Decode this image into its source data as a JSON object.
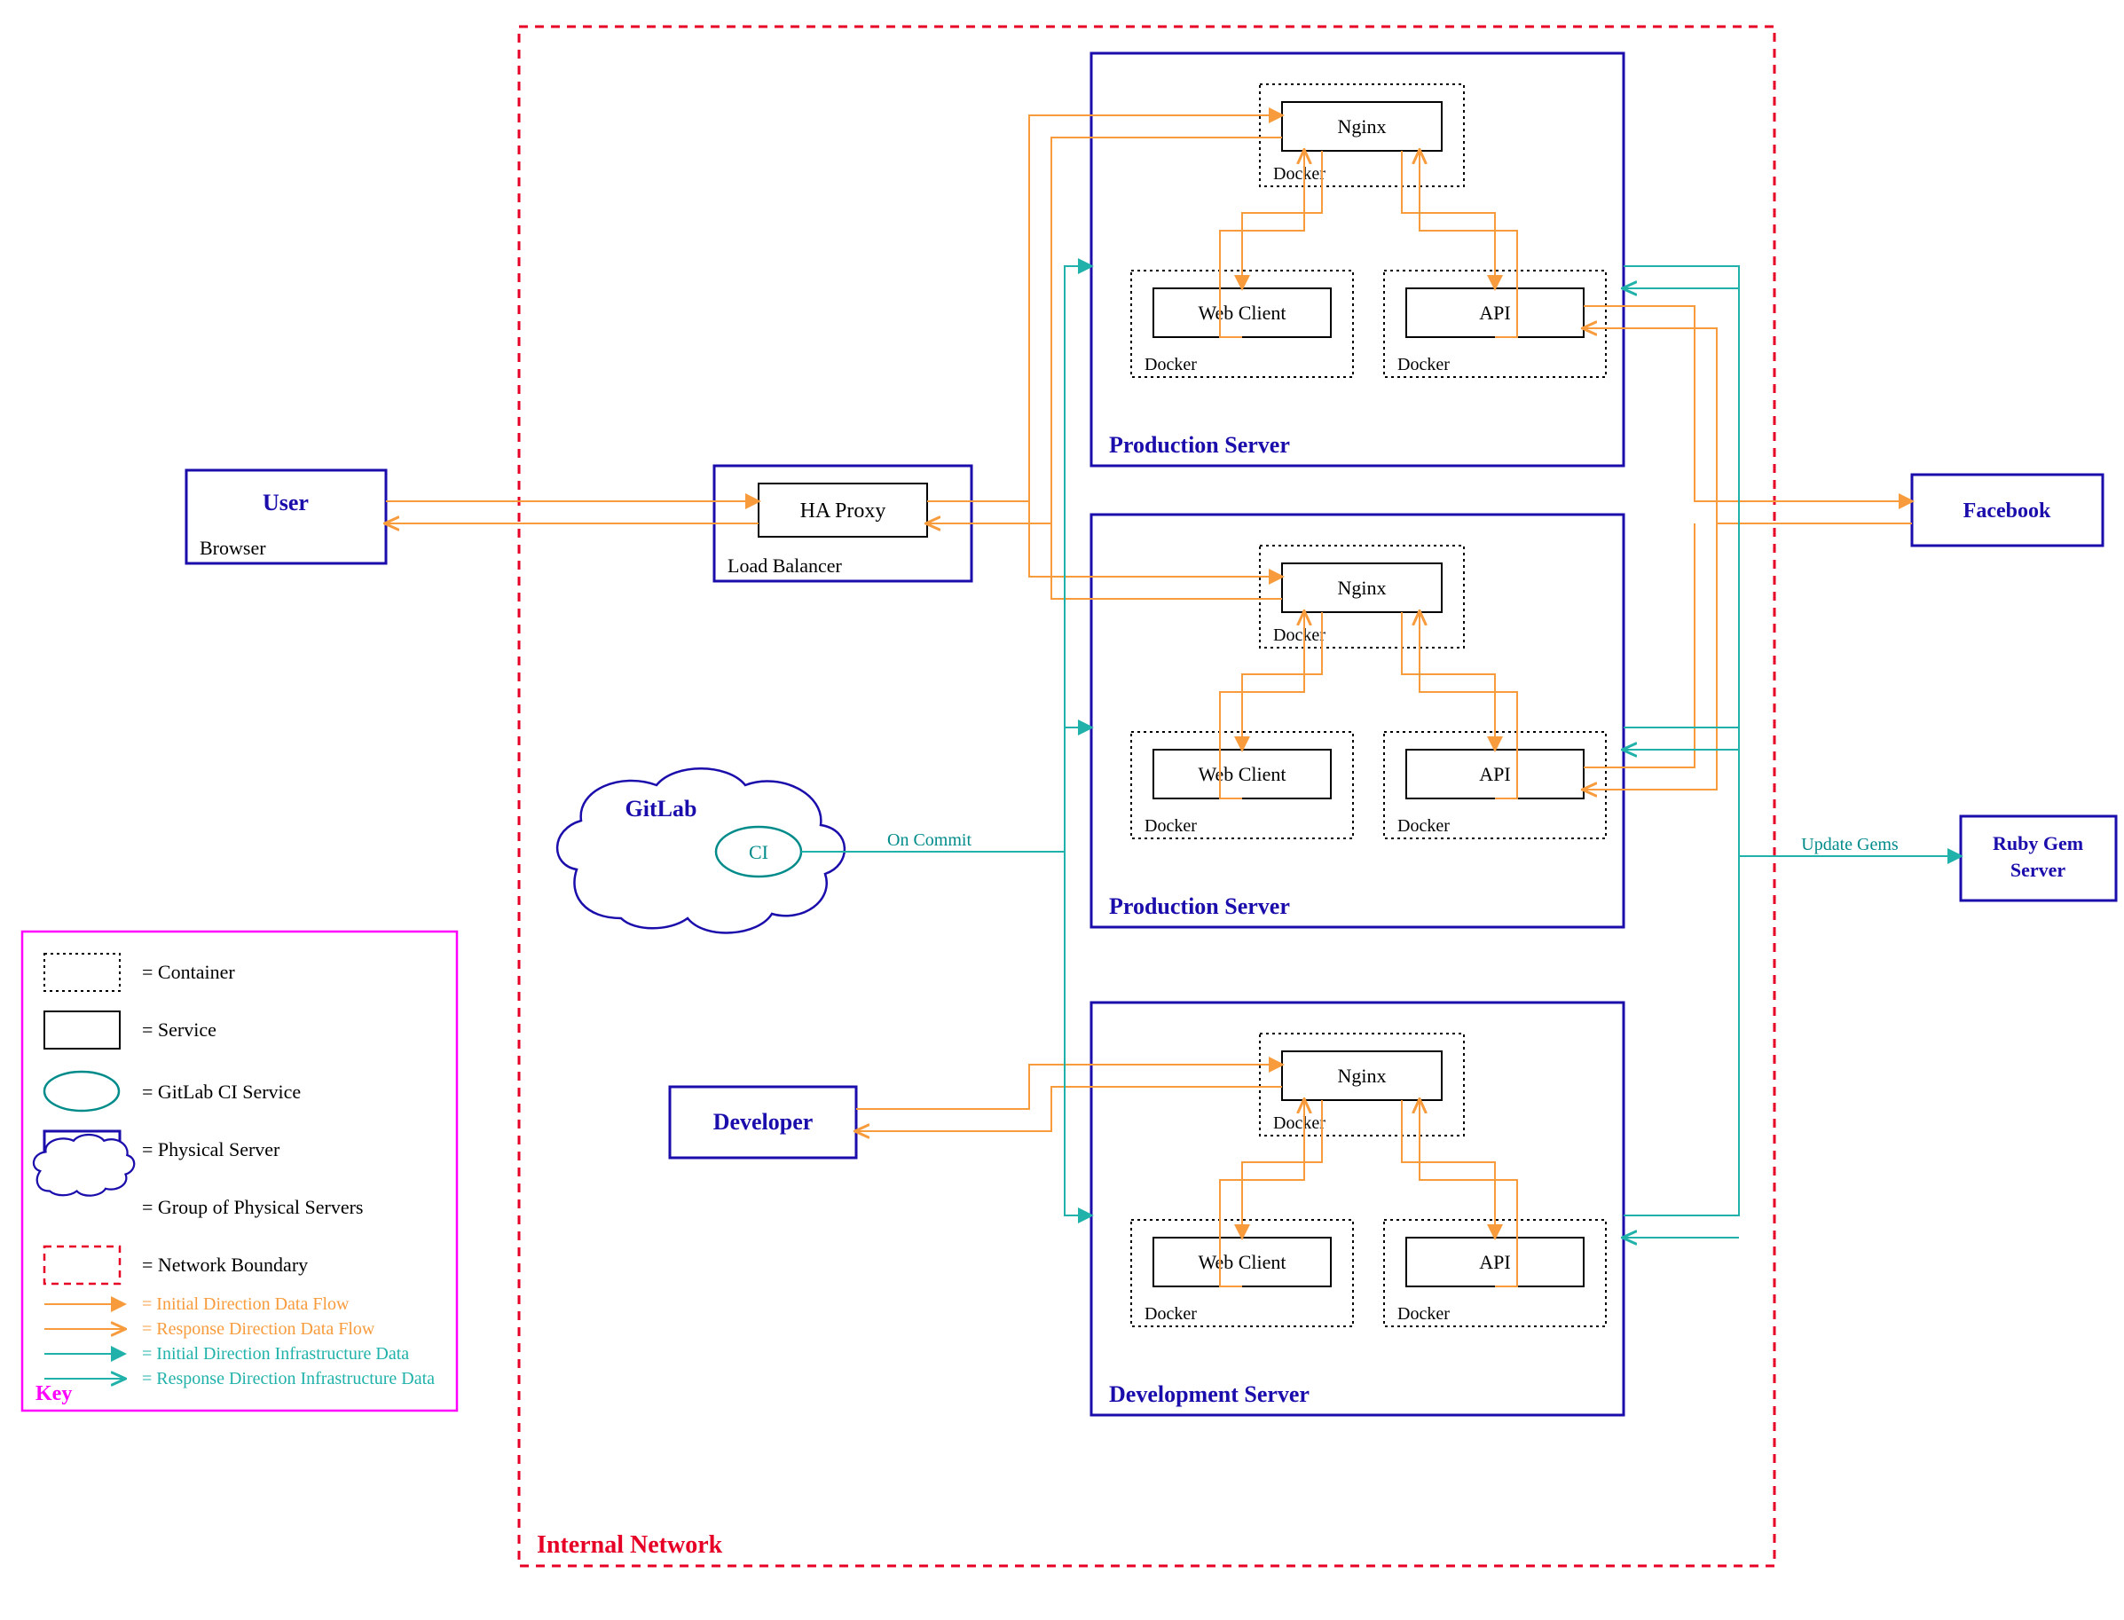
{
  "network": {
    "label": "Internal Network"
  },
  "user": {
    "title": "User",
    "subtitle": "Browser"
  },
  "haproxy": {
    "title": "HA Proxy",
    "subtitle": "Load Balancer"
  },
  "gitlab": {
    "title": "GitLab",
    "ci": "CI",
    "on_commit": "On Commit"
  },
  "developer": {
    "title": "Developer"
  },
  "facebook": {
    "title": "Facebook"
  },
  "rubygem": {
    "title1": "Ruby Gem",
    "title2": "Server",
    "update": "Update Gems"
  },
  "servers": {
    "prod1": {
      "label": "Production  Server"
    },
    "prod2": {
      "label": "Production  Server"
    },
    "dev": {
      "label": "Development  Server"
    }
  },
  "docker": {
    "nginx": "Nginx",
    "webclient": "Web Client",
    "api": "API",
    "docker": "Docker"
  },
  "key": {
    "title": "Key",
    "container": "= Container",
    "service": "= Service",
    "gitlab_ci": "= GitLab CI Service",
    "physical": "= Physical Server",
    "group": "= Group of Physical Servers",
    "boundary": "= Network Boundary",
    "init_data": "= Initial Direction Data Flow",
    "resp_data": "= Response Direction Data Flow",
    "init_infra": "= Initial Direction Infrastructure Data",
    "resp_infra": "= Response Direction Infrastructure Data"
  }
}
